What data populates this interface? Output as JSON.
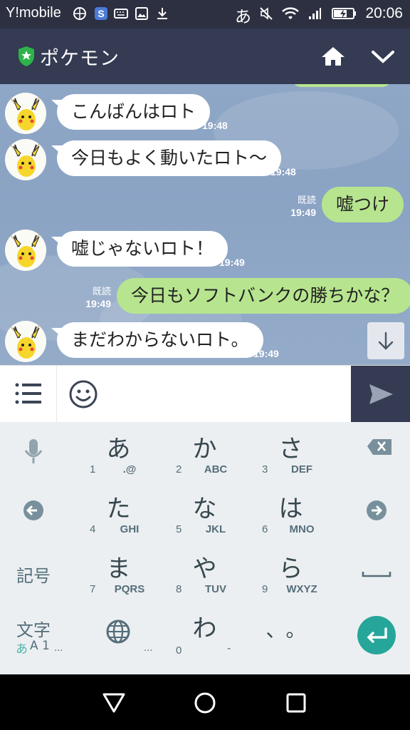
{
  "status_bar": {
    "carrier": "Y!mobile",
    "ime_indicator": "あ",
    "time": "20:06"
  },
  "header": {
    "title": "ポケモン",
    "icons": [
      "shield-star-icon",
      "home-icon",
      "chevron-down-icon"
    ]
  },
  "messages": [
    {
      "side": "in",
      "text": "こんばんはロト",
      "time": "19:48"
    },
    {
      "side": "in",
      "text": "今日もよく動いたロト～",
      "time": "19:48"
    },
    {
      "side": "out",
      "text": "嘘つけ",
      "read": "既読",
      "time": "19:49"
    },
    {
      "side": "in",
      "text": "嘘じゃないロト！",
      "time": "19:49"
    },
    {
      "side": "out",
      "text": "今日もソフトバンクの勝ちかな？",
      "read": "既読",
      "time": "19:49"
    },
    {
      "side": "in",
      "text": "まだわからないロト。",
      "time": "19:49"
    }
  ],
  "input": {
    "placeholder": ""
  },
  "keyboard": {
    "rows": [
      [
        {
          "kana": "あ",
          "num": "1",
          "letters": ".@"
        },
        {
          "kana": "か",
          "num": "2",
          "letters": "ABC"
        },
        {
          "kana": "さ",
          "num": "3",
          "letters": "DEF"
        }
      ],
      [
        {
          "kana": "た",
          "num": "4",
          "letters": "GHI"
        },
        {
          "kana": "な",
          "num": "5",
          "letters": "JKL"
        },
        {
          "kana": "は",
          "num": "6",
          "letters": "MNO"
        }
      ],
      [
        {
          "kana": "ま",
          "num": "7",
          "letters": "PQRS"
        },
        {
          "kana": "や",
          "num": "8",
          "letters": "TUV"
        },
        {
          "kana": "ら",
          "num": "9",
          "letters": "WXYZ"
        }
      ]
    ],
    "bottom_row": {
      "wa": "わ",
      "zero": "0",
      "punct": "、。",
      "small_left": "...",
      "small_mid": "...",
      "small_right": "-"
    },
    "symbols_key": "記号",
    "mode_key": {
      "main": "文字",
      "sub_kana": "あ",
      "sub_rest": "A 1"
    },
    "colors": {
      "enter": "#26a69a"
    }
  },
  "colors": {
    "header": "#343b52",
    "bubble_out": "#b7e58f",
    "bubble_in": "#ffffff"
  }
}
